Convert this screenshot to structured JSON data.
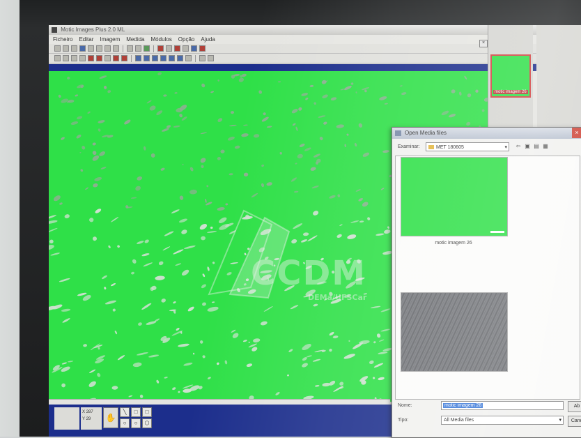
{
  "app": {
    "title": "Motic Images Plus 2.0 ML"
  },
  "menu": [
    "Ficheiro",
    "Editar",
    "Imagem",
    "Medida",
    "Módulos",
    "Opção",
    "Ajuda"
  ],
  "watermark": {
    "text": "CCDM",
    "subtext": "DEMa/UFSCar"
  },
  "status": {
    "x_label": "X",
    "x_value": "287",
    "y_label": "Y",
    "y_value": "29"
  },
  "side_panel": {
    "thumb_label": "motic imagem 26"
  },
  "dialog": {
    "title": "Open Media files",
    "look_in_label": "Examinar:",
    "look_in_value": "MET 180605",
    "thumb1_caption": "motic imagem 26",
    "filename_label": "Nome:",
    "filename_value": "motic imagem 26",
    "filetype_label": "Tipo:",
    "filetype_value": "All Media files",
    "open_label": "Ab",
    "cancel_label": "Canc"
  },
  "colors": {
    "image_green": "#2fe048",
    "status_blue": "#1c2e8c",
    "close_red": "#d04a3e"
  },
  "icons": [
    "app-icon",
    "folder-icon",
    "hand-tool-icon",
    "close-icon",
    "chevron-down-icon"
  ]
}
